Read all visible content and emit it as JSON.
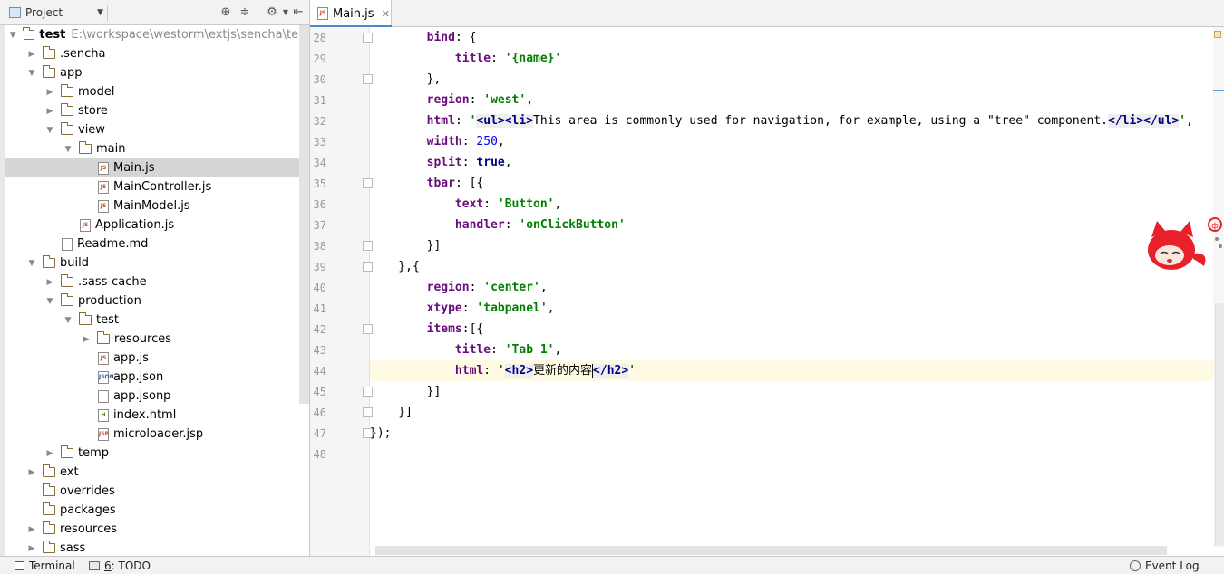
{
  "project_panel": {
    "selector_label": "Project",
    "tree": [
      {
        "label": "test",
        "path": "E:\\workspace\\westorm\\extjs\\sencha\\test",
        "kind": "folder",
        "arrow": "▼",
        "root": true
      },
      {
        "label": ".sencha",
        "kind": "folder",
        "arrow": "▶"
      },
      {
        "label": "app",
        "kind": "folder",
        "arrow": "▼"
      },
      {
        "label": "model",
        "kind": "folder",
        "arrow": "▶"
      },
      {
        "label": "store",
        "kind": "folder",
        "arrow": "▶"
      },
      {
        "label": "view",
        "kind": "folder",
        "arrow": "▼"
      },
      {
        "label": "main",
        "kind": "folder",
        "arrow": "▼"
      },
      {
        "label": "Main.js",
        "kind": "js",
        "selected": true
      },
      {
        "label": "MainController.js",
        "kind": "js"
      },
      {
        "label": "MainModel.js",
        "kind": "js"
      },
      {
        "label": "Application.js",
        "kind": "js"
      },
      {
        "label": "Readme.md",
        "kind": "md"
      },
      {
        "label": "build",
        "kind": "folder",
        "arrow": "▼"
      },
      {
        "label": ".sass-cache",
        "kind": "folder",
        "arrow": "▶"
      },
      {
        "label": "production",
        "kind": "folder",
        "arrow": "▼"
      },
      {
        "label": "test",
        "kind": "folder",
        "arrow": "▼"
      },
      {
        "label": "resources",
        "kind": "folder",
        "arrow": "▶"
      },
      {
        "label": "app.js",
        "kind": "js"
      },
      {
        "label": "app.json",
        "kind": "json"
      },
      {
        "label": "app.jsonp",
        "kind": "file"
      },
      {
        "label": "index.html",
        "kind": "html"
      },
      {
        "label": "microloader.jsp",
        "kind": "jsp"
      },
      {
        "label": "temp",
        "kind": "folder",
        "arrow": "▶"
      },
      {
        "label": "ext",
        "kind": "folder",
        "arrow": "▶"
      },
      {
        "label": "overrides",
        "kind": "folder",
        "arrow": ""
      },
      {
        "label": "packages",
        "kind": "folder",
        "arrow": ""
      },
      {
        "label": "resources",
        "kind": "folder",
        "arrow": "▶"
      },
      {
        "label": "sass",
        "kind": "folder",
        "arrow": "▶"
      }
    ]
  },
  "editor": {
    "tab_label": "Main.js",
    "icon_js": "JS",
    "icon_json": "JSON",
    "icon_html": "H",
    "icon_jsp": "JSP",
    "line_numbers": [
      "28",
      "29",
      "30",
      "31",
      "32",
      "33",
      "34",
      "35",
      "36",
      "37",
      "38",
      "39",
      "40",
      "41",
      "42",
      "43",
      "44",
      "45",
      "46",
      "47",
      "48"
    ]
  },
  "status_bar": {
    "terminal_label": "Terminal",
    "todo_prefix": "6",
    "todo_suffix": ": TODO",
    "event_log_label": "Event Log"
  },
  "colors": {
    "current_line": "#fffae3",
    "selected_row": "#d5d5d5",
    "accent": "#4a88c7"
  }
}
